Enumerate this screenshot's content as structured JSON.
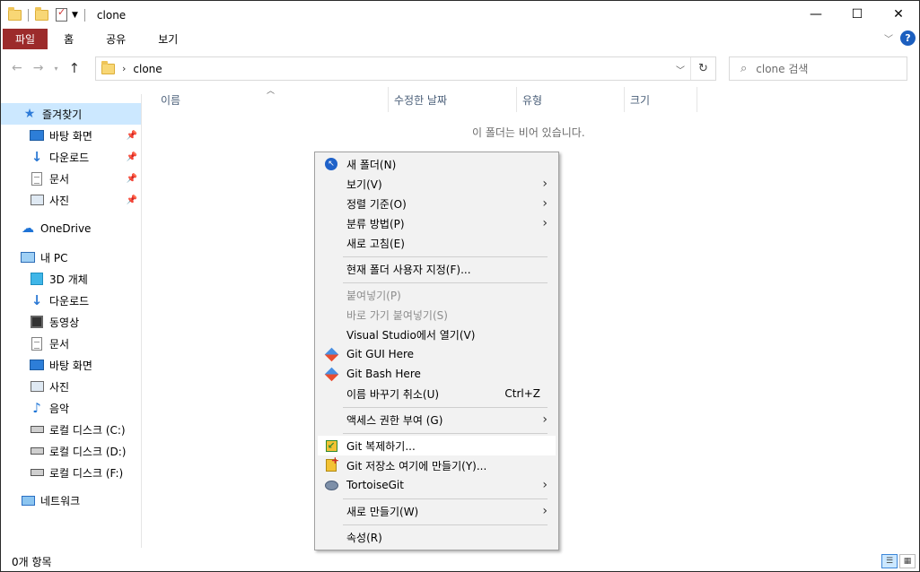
{
  "window": {
    "title": "clone"
  },
  "window_buttons": {
    "minimize": "—",
    "maximize": "☐",
    "close": "✕"
  },
  "ribbon": {
    "tabs": [
      "파일",
      "홈",
      "공유",
      "보기"
    ]
  },
  "address": {
    "path": "clone",
    "search_placeholder": "clone 검색"
  },
  "nav": {
    "items": [
      {
        "label": "즐겨찾기",
        "icon": "star-icon"
      },
      {
        "label": "바탕 화면",
        "icon": "desktop-icon",
        "pinned": true
      },
      {
        "label": "다운로드",
        "icon": "download-icon",
        "pinned": true
      },
      {
        "label": "문서",
        "icon": "document-icon",
        "pinned": true
      },
      {
        "label": "사진",
        "icon": "picture-icon",
        "pinned": true
      },
      {
        "label": "OneDrive",
        "icon": "cloud-icon"
      },
      {
        "label": "내 PC",
        "icon": "pc-icon"
      },
      {
        "label": "3D 개체",
        "icon": "3d-object-icon"
      },
      {
        "label": "다운로드",
        "icon": "download-icon"
      },
      {
        "label": "동영상",
        "icon": "video-icon"
      },
      {
        "label": "문서",
        "icon": "document-icon"
      },
      {
        "label": "바탕 화면",
        "icon": "desktop-icon"
      },
      {
        "label": "사진",
        "icon": "picture-icon"
      },
      {
        "label": "음악",
        "icon": "music-icon"
      },
      {
        "label": "로컬 디스크 (C:)",
        "icon": "drive-icon"
      },
      {
        "label": "로컬 디스크 (D:)",
        "icon": "drive-icon"
      },
      {
        "label": "로컬 디스크 (F:)",
        "icon": "drive-icon"
      },
      {
        "label": "네트워크",
        "icon": "network-icon"
      }
    ]
  },
  "columns": [
    "이름",
    "수정한 날짜",
    "유형",
    "크기"
  ],
  "empty_message": "이 폴더는 비어 있습니다.",
  "status": {
    "item_count": "0개 항목"
  },
  "context_menu": {
    "items": [
      {
        "label": "새 폴더(N)",
        "icon": "new-folder-icon"
      },
      {
        "label": "보기(V)",
        "submenu": true
      },
      {
        "label": "정렬 기준(O)",
        "submenu": true
      },
      {
        "label": "분류 방법(P)",
        "submenu": true
      },
      {
        "label": "새로 고침(E)"
      },
      {
        "label": "현재 폴더 사용자 지정(F)..."
      },
      {
        "label": "붙여넣기(P)",
        "disabled": true
      },
      {
        "label": "바로 가기 붙여넣기(S)",
        "disabled": true
      },
      {
        "label": "Visual Studio에서 열기(V)"
      },
      {
        "label": "Git GUI Here",
        "icon": "git-gui-icon"
      },
      {
        "label": "Git Bash Here",
        "icon": "git-bash-icon"
      },
      {
        "label": "이름 바꾸기 취소(U)",
        "accelerator": "Ctrl+Z"
      },
      {
        "label": "액세스 권한 부여 (G)",
        "submenu": true
      },
      {
        "label": "Git 복제하기...",
        "icon": "git-clone-icon",
        "highlighted": true
      },
      {
        "label": "Git 저장소 여기에 만들기(Y)...",
        "icon": "git-create-repo-icon"
      },
      {
        "label": "TortoiseGit",
        "icon": "tortoisegit-icon",
        "submenu": true
      },
      {
        "label": "새로 만들기(W)",
        "submenu": true
      },
      {
        "label": "속성(R)"
      }
    ]
  }
}
